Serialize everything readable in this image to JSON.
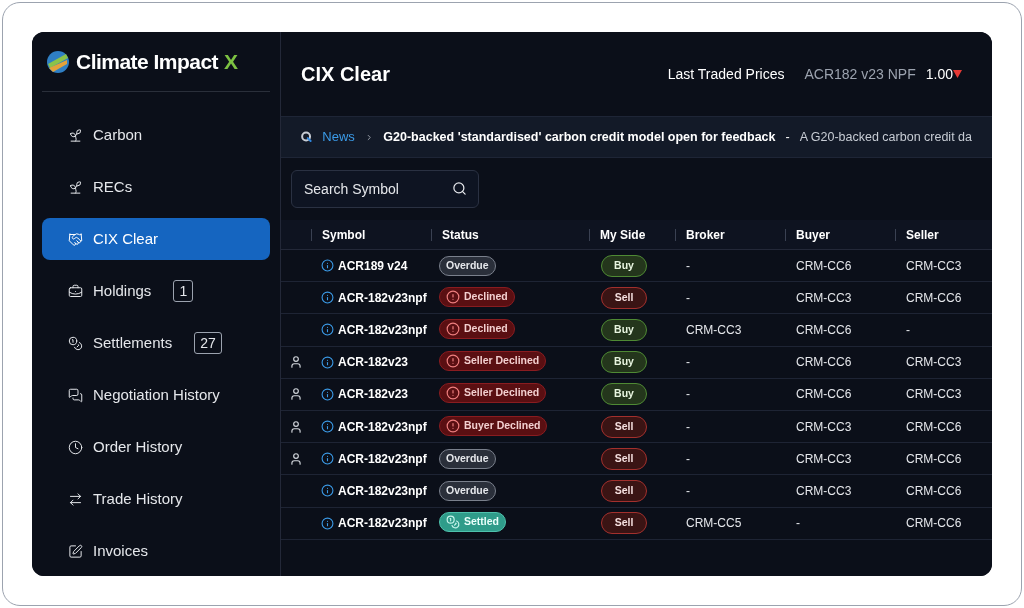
{
  "brand": {
    "name": "Climate Impact",
    "mark": "X"
  },
  "sidebar": {
    "items": [
      {
        "label": "Carbon",
        "selected": false
      },
      {
        "label": "RECs",
        "selected": false
      },
      {
        "label": "CIX Clear",
        "selected": true
      },
      {
        "label": "Holdings",
        "badge": "1",
        "selected": false
      },
      {
        "label": "Settlements",
        "badge": "27",
        "selected": false
      },
      {
        "label": "Negotiation History",
        "selected": false
      },
      {
        "label": "Order History",
        "selected": false
      },
      {
        "label": "Trade History",
        "selected": false
      },
      {
        "label": "Invoices",
        "selected": false
      }
    ]
  },
  "header": {
    "title": "CIX Clear",
    "prices_label": "Last Traded Prices",
    "symbol": "ACR182 v23 NPF",
    "price": "1.00"
  },
  "news": {
    "label": "News",
    "headline": "G20-backed 'standardised' carbon credit model open for feedback",
    "separator": "-",
    "summary": "A G20-backed carbon credit da"
  },
  "search": {
    "placeholder": "Search Symbol"
  },
  "table": {
    "columns": [
      "Symbol",
      "Status",
      "My Side",
      "Broker",
      "Buyer",
      "Seller"
    ],
    "rows": [
      {
        "user": false,
        "symbol": "ACR189 v24",
        "status": {
          "kind": "overdue",
          "label": "Overdue"
        },
        "side": {
          "kind": "buy",
          "label": "Buy"
        },
        "broker": "-",
        "buyer": "CRM-CC6",
        "seller": "CRM-CC3"
      },
      {
        "user": false,
        "symbol": "ACR-182v23npf",
        "status": {
          "kind": "declined",
          "label": "Declined"
        },
        "side": {
          "kind": "sell",
          "label": "Sell"
        },
        "broker": "-",
        "buyer": "CRM-CC3",
        "seller": "CRM-CC6"
      },
      {
        "user": false,
        "symbol": "ACR-182v23npf",
        "status": {
          "kind": "declined",
          "label": "Declined"
        },
        "side": {
          "kind": "buy",
          "label": "Buy"
        },
        "broker": "CRM-CC3",
        "buyer": "CRM-CC6",
        "seller": "-"
      },
      {
        "user": true,
        "symbol": "ACR-182v23",
        "status": {
          "kind": "declined",
          "label": "Seller Declined"
        },
        "side": {
          "kind": "buy",
          "label": "Buy"
        },
        "broker": "-",
        "buyer": "CRM-CC6",
        "seller": "CRM-CC3"
      },
      {
        "user": true,
        "symbol": "ACR-182v23",
        "status": {
          "kind": "declined",
          "label": "Seller Declined"
        },
        "side": {
          "kind": "buy",
          "label": "Buy"
        },
        "broker": "-",
        "buyer": "CRM-CC6",
        "seller": "CRM-CC3"
      },
      {
        "user": true,
        "symbol": "ACR-182v23npf",
        "status": {
          "kind": "declined",
          "label": "Buyer Declined"
        },
        "side": {
          "kind": "sell",
          "label": "Sell"
        },
        "broker": "-",
        "buyer": "CRM-CC3",
        "seller": "CRM-CC6"
      },
      {
        "user": true,
        "symbol": "ACR-182v23npf",
        "status": {
          "kind": "overdue",
          "label": "Overdue"
        },
        "side": {
          "kind": "sell",
          "label": "Sell"
        },
        "broker": "-",
        "buyer": "CRM-CC3",
        "seller": "CRM-CC6"
      },
      {
        "user": false,
        "symbol": "ACR-182v23npf",
        "status": {
          "kind": "overdue",
          "label": "Overdue"
        },
        "side": {
          "kind": "sell",
          "label": "Sell"
        },
        "broker": "-",
        "buyer": "CRM-CC3",
        "seller": "CRM-CC6"
      },
      {
        "user": false,
        "symbol": "ACR-182v23npf",
        "status": {
          "kind": "settled",
          "label": "Settled"
        },
        "side": {
          "kind": "sell",
          "label": "Sell"
        },
        "broker": "CRM-CC5",
        "buyer": "-",
        "seller": "CRM-CC6"
      }
    ]
  }
}
